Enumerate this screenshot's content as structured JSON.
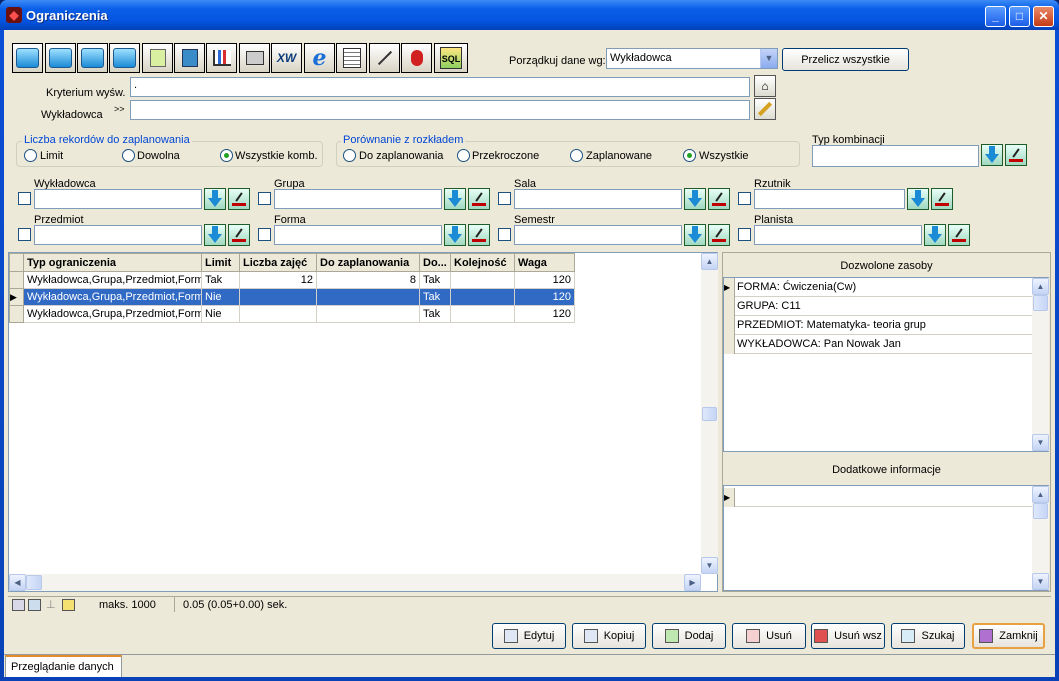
{
  "window": {
    "title": "Ograniczenia",
    "min": "_",
    "max": "□",
    "close": "✕"
  },
  "toolbar": {
    "buttons": [
      "first-icon",
      "prev-icon",
      "next-icon",
      "last-icon",
      "refresh-icon",
      "copy-icon",
      "chart-icon",
      "print-icon",
      "xw-icon",
      "browser-icon",
      "report-icon",
      "wand-icon",
      "filter-icon",
      "sql-icon"
    ],
    "sort_label": "Porządkuj dane wg:",
    "sort_value": "Wykładowca",
    "recalc_label": "Przelicz wszystkie"
  },
  "criteria": {
    "label": "Kryterium wyśw.",
    "value": ".",
    "lecturer_label": "Wykładowca",
    "lecturer_arrow": ">>",
    "lecturer_value": ""
  },
  "group_records": {
    "title": "Liczba rekordów do zaplanowania",
    "options": [
      "Limit",
      "Dowolna",
      "Wszystkie komb."
    ],
    "selected": 2
  },
  "group_compare": {
    "title": "Porównanie z rozkładem",
    "options": [
      "Do zaplanowania",
      "Przekroczone",
      "Zaplanowane",
      "Wszystkie"
    ],
    "selected": 3
  },
  "combination": {
    "label": "Typ kombinacji",
    "value": ""
  },
  "filters": [
    {
      "label": "Wykładowca",
      "value": ""
    },
    {
      "label": "Grupa",
      "value": ""
    },
    {
      "label": "Sala",
      "value": ""
    },
    {
      "label": "Rzutnik",
      "value": ""
    },
    {
      "label": "Przedmiot",
      "value": ""
    },
    {
      "label": "Forma",
      "value": ""
    },
    {
      "label": "Semestr",
      "value": ""
    },
    {
      "label": "Planista",
      "value": ""
    }
  ],
  "grid": {
    "columns": [
      "Typ ograniczenia",
      "Limit",
      "Liczba zajęć",
      "Do zaplanowania",
      "Do...",
      "Kolejność",
      "Waga"
    ],
    "rows": [
      [
        "Wykładowca,Grupa,Przedmiot,Forma",
        "Tak",
        "12",
        "8",
        "Tak",
        "",
        "120"
      ],
      [
        "Wykładowca,Grupa,Przedmiot,Forma",
        "Nie",
        "",
        "",
        "Tak",
        "",
        "120"
      ],
      [
        "Wykładowca,Grupa,Przedmiot,Forma",
        "Nie",
        "",
        "",
        "Tak",
        "",
        "120"
      ]
    ],
    "selected_row": 1
  },
  "resources": {
    "title": "Dozwolone zasoby",
    "items": [
      "FORMA: Ćwiczenia(Cw)",
      "GRUPA: C11",
      "PRZEDMIOT: Matematyka- teoria grup",
      "WYKŁADOWCA: Pan Nowak Jan"
    ]
  },
  "extra_info": {
    "title": "Dodatkowe informacje"
  },
  "status": {
    "max": "maks. 1000",
    "time": "0.05 (0.05+0.00) sek."
  },
  "actions": {
    "edit": "Edytuj",
    "copy": "Kopiuj",
    "add": "Dodaj",
    "remove": "Usuń",
    "remove_all": "Usuń wsz",
    "search": "Szukaj",
    "close": "Zamknij"
  },
  "tab": {
    "label": "Przeglądanie danych"
  }
}
